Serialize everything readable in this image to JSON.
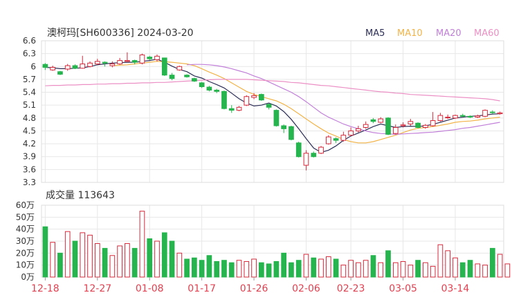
{
  "chart_data": {
    "type": "candlestick",
    "title": "澳柯玛[SH600336] 2024-03-20",
    "legend": [
      {
        "name": "MA5",
        "color": "#2b2d56"
      },
      {
        "name": "MA10",
        "color": "#f2b347"
      },
      {
        "name": "MA20",
        "color": "#c17fd9"
      },
      {
        "name": "MA60",
        "color": "#eb8fc4"
      }
    ],
    "price_axis": {
      "ylim": [
        3.3,
        6.6
      ],
      "ticks": [
        "6.6",
        "6.3",
        "6",
        "5.7",
        "5.4",
        "5.1",
        "4.8",
        "4.5",
        "4.2",
        "3.9",
        "3.6",
        "3.3"
      ]
    },
    "date_ticks": [
      {
        "label": "12-18",
        "index": 0
      },
      {
        "label": "12-27",
        "index": 7
      },
      {
        "label": "01-08",
        "index": 14
      },
      {
        "label": "01-17",
        "index": 21
      },
      {
        "label": "01-26",
        "index": 28
      },
      {
        "label": "02-06",
        "index": 35
      },
      {
        "label": "02-23",
        "index": 41
      },
      {
        "label": "03-05",
        "index": 48
      },
      {
        "label": "03-14",
        "index": 55
      }
    ],
    "candles": [
      [
        6.05,
        5.98,
        6.08,
        5.92
      ],
      [
        5.92,
        5.98,
        6.02,
        5.9
      ],
      [
        5.88,
        5.82,
        5.9,
        5.8
      ],
      [
        5.94,
        6.02,
        6.06,
        5.9
      ],
      [
        6.02,
        5.96,
        6.05,
        5.94
      ],
      [
        5.96,
        6.06,
        6.25,
        5.95
      ],
      [
        6.0,
        6.08,
        6.12,
        5.98
      ],
      [
        6.06,
        6.12,
        6.18,
        6.04
      ],
      [
        6.1,
        6.08,
        6.12,
        6.0
      ],
      [
        6.02,
        6.06,
        6.12,
        5.98
      ],
      [
        6.06,
        6.14,
        6.2,
        6.04
      ],
      [
        6.12,
        6.14,
        6.33,
        6.1
      ],
      [
        6.14,
        6.1,
        6.16,
        6.05
      ],
      [
        6.08,
        6.27,
        6.3,
        6.05
      ],
      [
        6.22,
        6.18,
        6.25,
        6.15
      ],
      [
        6.16,
        6.24,
        6.28,
        6.12
      ],
      [
        6.2,
        5.8,
        6.2,
        5.78
      ],
      [
        5.8,
        5.72,
        5.85,
        5.68
      ],
      [
        5.92,
        6.0,
        6.02,
        5.9
      ],
      [
        5.8,
        5.76,
        5.82,
        5.74
      ],
      [
        5.72,
        5.66,
        5.74,
        5.64
      ],
      [
        5.62,
        5.53,
        5.64,
        5.5
      ],
      [
        5.52,
        5.45,
        5.55,
        5.42
      ],
      [
        5.45,
        5.42,
        5.48,
        5.38
      ],
      [
        5.42,
        5.02,
        5.44,
        5.0
      ],
      [
        5.02,
        4.98,
        5.1,
        4.92
      ],
      [
        4.98,
        5.05,
        5.08,
        4.96
      ],
      [
        5.1,
        5.3,
        5.33,
        5.08
      ],
      [
        5.28,
        5.32,
        5.38,
        5.24
      ],
      [
        5.35,
        5.22,
        5.37,
        5.2
      ],
      [
        5.12,
        5.05,
        5.14,
        5.0
      ],
      [
        4.98,
        4.62,
        5.0,
        4.6
      ],
      [
        4.62,
        4.55,
        4.65,
        4.45
      ],
      [
        4.6,
        4.3,
        4.62,
        4.28
      ],
      [
        4.22,
        3.9,
        4.25,
        3.88
      ],
      [
        3.7,
        3.98,
        4.05,
        3.58
      ],
      [
        3.98,
        3.9,
        4.02,
        3.88
      ],
      [
        3.98,
        4.12,
        4.15,
        3.96
      ],
      [
        4.2,
        4.36,
        4.4,
        4.18
      ],
      [
        4.32,
        4.28,
        4.35,
        4.22
      ],
      [
        4.28,
        4.4,
        4.48,
        4.25
      ],
      [
        4.4,
        4.5,
        4.58,
        4.38
      ],
      [
        4.5,
        4.55,
        4.62,
        4.46
      ],
      [
        4.58,
        4.65,
        4.72,
        4.55
      ],
      [
        4.76,
        4.72,
        4.8,
        4.68
      ],
      [
        4.7,
        4.78,
        4.82,
        4.68
      ],
      [
        4.8,
        4.42,
        4.82,
        4.4
      ],
      [
        4.44,
        4.58,
        4.65,
        4.42
      ],
      [
        4.62,
        4.64,
        4.7,
        4.58
      ],
      [
        4.66,
        4.72,
        4.78,
        4.62
      ],
      [
        4.68,
        4.58,
        4.7,
        4.56
      ],
      [
        4.58,
        4.63,
        4.66,
        4.55
      ],
      [
        4.62,
        4.74,
        4.94,
        4.6
      ],
      [
        4.74,
        4.86,
        4.92,
        4.72
      ],
      [
        4.82,
        4.82,
        4.88,
        4.78
      ],
      [
        4.8,
        4.86,
        4.88,
        4.78
      ],
      [
        4.86,
        4.84,
        4.9,
        4.82
      ],
      [
        4.84,
        4.82,
        4.86,
        4.8
      ],
      [
        4.82,
        4.85,
        4.88,
        4.8
      ],
      [
        4.84,
        4.98,
        5.0,
        4.82
      ],
      [
        4.94,
        4.93,
        4.98,
        4.9
      ],
      [
        4.9,
        4.92,
        4.95,
        4.88
      ]
    ],
    "volume_title": "成交量 113643",
    "volume_axis": {
      "ylim": [
        0,
        60
      ],
      "ticks": [
        "60万",
        "50万",
        "40万",
        "30万",
        "20万",
        "10万",
        "0万"
      ]
    },
    "volumes": [
      42,
      29,
      20,
      38,
      30,
      37,
      35,
      28,
      24,
      18,
      26,
      28,
      24,
      55,
      32,
      30,
      37,
      30,
      20,
      15,
      16,
      14,
      18,
      13,
      14,
      12,
      14,
      13,
      15,
      12,
      11,
      13,
      20,
      12,
      14,
      19,
      16,
      15,
      17,
      15,
      10,
      14,
      12,
      14,
      18,
      12,
      22,
      12,
      13,
      10,
      14,
      12,
      9,
      27,
      22,
      16,
      12,
      14,
      11,
      10,
      24,
      19,
      11
    ],
    "ma_lines": {
      "MA5": [
        5.98,
        5.97,
        5.95,
        5.95,
        5.96,
        5.97,
        6.0,
        6.04,
        6.06,
        6.08,
        6.09,
        6.1,
        6.1,
        6.12,
        6.14,
        6.17,
        6.1,
        6.01,
        5.93,
        5.88,
        5.78,
        5.73,
        5.65,
        5.58,
        5.5,
        5.38,
        5.25,
        5.15,
        5.08,
        5.1,
        5.15,
        5.08,
        4.95,
        4.77,
        4.55,
        4.32,
        4.1,
        4.0,
        4.05,
        4.15,
        4.28,
        4.38,
        4.45,
        4.52,
        4.6,
        4.66,
        4.62,
        4.58,
        4.6,
        4.61,
        4.6,
        4.62,
        4.65,
        4.7,
        4.75,
        4.8,
        4.82,
        4.84,
        4.85,
        4.87,
        4.89,
        4.9
      ],
      "MA10": [
        null,
        null,
        null,
        null,
        null,
        null,
        null,
        null,
        null,
        6.02,
        6.03,
        6.04,
        6.06,
        6.08,
        6.1,
        6.12,
        6.11,
        6.1,
        6.08,
        6.06,
        6.02,
        5.95,
        5.87,
        5.8,
        5.72,
        5.62,
        5.52,
        5.42,
        5.35,
        5.3,
        5.25,
        5.2,
        5.12,
        5.02,
        4.9,
        4.78,
        4.66,
        4.55,
        4.45,
        4.38,
        4.3,
        4.25,
        4.22,
        4.22,
        4.25,
        4.3,
        4.35,
        4.4,
        4.46,
        4.52,
        4.56,
        4.58,
        4.6,
        4.63,
        4.66,
        4.7,
        4.72,
        4.73,
        4.75,
        4.78,
        4.8,
        4.82
      ],
      "MA20": [
        null,
        null,
        null,
        null,
        null,
        null,
        null,
        null,
        null,
        null,
        null,
        null,
        null,
        null,
        null,
        null,
        null,
        null,
        null,
        6.04,
        6.05,
        6.05,
        6.04,
        6.02,
        5.99,
        5.95,
        5.9,
        5.85,
        5.78,
        5.72,
        5.64,
        5.56,
        5.48,
        5.4,
        5.3,
        5.18,
        5.05,
        4.92,
        4.82,
        4.74,
        4.66,
        4.6,
        4.55,
        4.5,
        4.46,
        4.44,
        4.43,
        4.42,
        4.43,
        4.44,
        4.45,
        4.46,
        4.47,
        4.49,
        4.51,
        4.53,
        4.56,
        4.58,
        4.61,
        4.64,
        4.67,
        4.7
      ],
      "MA60": [
        5.55,
        5.56,
        5.56,
        5.57,
        5.57,
        5.58,
        5.58,
        5.59,
        5.59,
        5.6,
        5.6,
        5.61,
        5.61,
        5.62,
        5.62,
        5.63,
        5.63,
        5.64,
        5.65,
        5.66,
        5.67,
        5.68,
        5.69,
        5.7,
        5.7,
        5.7,
        5.7,
        5.7,
        5.69,
        5.68,
        5.67,
        5.66,
        5.65,
        5.63,
        5.62,
        5.6,
        5.58,
        5.56,
        5.55,
        5.53,
        5.51,
        5.49,
        5.47,
        5.45,
        5.43,
        5.41,
        5.4,
        5.38,
        5.37,
        5.35,
        5.34,
        5.33,
        5.32,
        5.31,
        5.3,
        5.29,
        5.28,
        5.27,
        5.26,
        5.25,
        5.23,
        5.2
      ]
    },
    "colors": {
      "up": "#d6283a",
      "down": "#25b44d",
      "grid": "#e7e7e7",
      "axis_text": "#333333",
      "date_text": "#e04050"
    }
  }
}
